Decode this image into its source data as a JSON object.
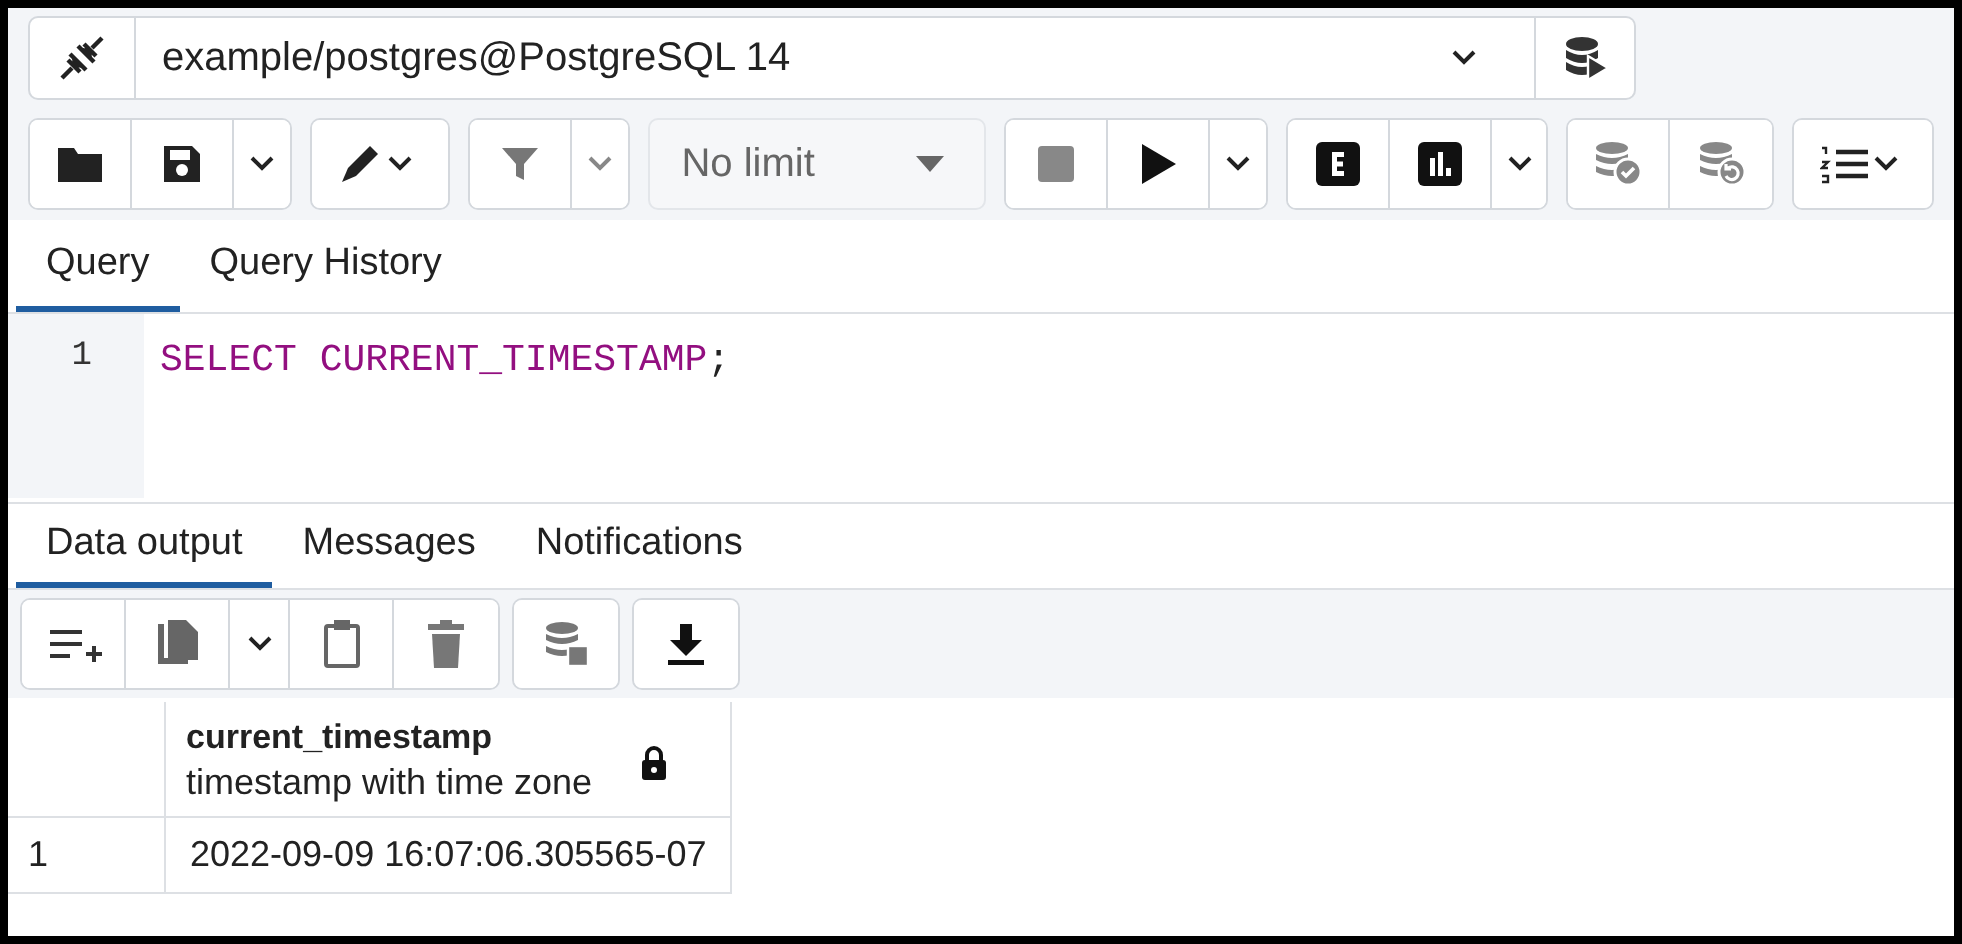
{
  "connection": {
    "label": "example/postgres@PostgreSQL 14"
  },
  "toolbar": {
    "limit": "No limit"
  },
  "query_tabs": [
    {
      "label": "Query",
      "selected": true
    },
    {
      "label": "Query History",
      "selected": false
    }
  ],
  "editor": {
    "lines": [
      {
        "number": "1",
        "tokens": [
          {
            "text": "SELECT",
            "kind": "keyword"
          },
          {
            "text": "CURRENT_TIMESTAMP",
            "kind": "keyword"
          },
          {
            "text": ";",
            "kind": "punct"
          }
        ]
      }
    ]
  },
  "output_tabs": [
    {
      "label": "Data output",
      "selected": true
    },
    {
      "label": "Messages",
      "selected": false
    },
    {
      "label": "Notifications",
      "selected": false
    }
  ],
  "table": {
    "columns": [
      {
        "name": "current_timestamp",
        "type": "timestamp with time zone",
        "locked": true
      }
    ],
    "rows": [
      {
        "number": "1",
        "cells": [
          "2022-09-09 16:07:06.305565-07"
        ]
      }
    ]
  }
}
